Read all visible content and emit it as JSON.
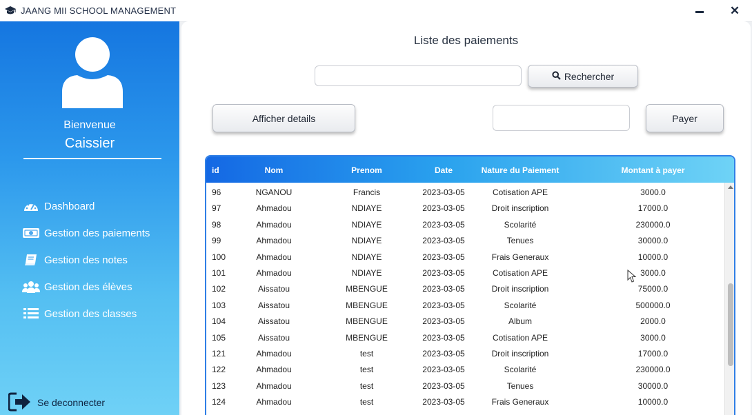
{
  "window": {
    "title": "JAANG MII SCHOOL MANAGEMENT",
    "icon": "graduation-cap-icon"
  },
  "sidebar": {
    "welcome": "Bienvenue",
    "role": "Caissier",
    "items": [
      {
        "label": "Dashboard",
        "icon": "dashboard-gauge-icon"
      },
      {
        "label": "Gestion des paiements",
        "icon": "money-bill-icon"
      },
      {
        "label": "Gestion des notes",
        "icon": "book-icon"
      },
      {
        "label": "Gestion des élèves",
        "icon": "users-icon"
      },
      {
        "label": "Gestion des classes",
        "icon": "list-icon"
      }
    ],
    "logout": "Se deconnecter"
  },
  "main": {
    "title": "Liste des paiements",
    "search": {
      "value": "",
      "button_label": "Rechercher"
    },
    "details_button": "Afficher details",
    "amount_input": {
      "value": ""
    },
    "pay_button": "Payer"
  },
  "table": {
    "columns": [
      "id",
      "Nom",
      "Prenom",
      "Date",
      "Nature du Paiement",
      "Montant à payer"
    ],
    "rows": [
      [
        "96",
        "NGANOU",
        "Francis",
        "2023-03-05",
        "Cotisation APE",
        "3000.0"
      ],
      [
        "97",
        "Ahmadou",
        "NDIAYE",
        "2023-03-05",
        "Droit inscription",
        "17000.0"
      ],
      [
        "98",
        "Ahmadou",
        "NDIAYE",
        "2023-03-05",
        "Scolarité",
        "230000.0"
      ],
      [
        "99",
        "Ahmadou",
        "NDIAYE",
        "2023-03-05",
        "Tenues",
        "30000.0"
      ],
      [
        "100",
        "Ahmadou",
        "NDIAYE",
        "2023-03-05",
        "Frais Generaux",
        "10000.0"
      ],
      [
        "101",
        "Ahmadou",
        "NDIAYE",
        "2023-03-05",
        "Cotisation APE",
        "3000.0"
      ],
      [
        "102",
        "Aissatou",
        "MBENGUE",
        "2023-03-05",
        "Droit inscription",
        "75000.0"
      ],
      [
        "103",
        "Aissatou",
        "MBENGUE",
        "2023-03-05",
        "Scolarité",
        "500000.0"
      ],
      [
        "104",
        "Aissatou",
        "MBENGUE",
        "2023-03-05",
        "Album",
        "2000.0"
      ],
      [
        "105",
        "Aissatou",
        "MBENGUE",
        "2023-03-05",
        "Cotisation APE",
        "3000.0"
      ],
      [
        "121",
        "Ahmadou",
        "test",
        "2023-03-05",
        "Droit inscription",
        "17000.0"
      ],
      [
        "122",
        "Ahmadou",
        "test",
        "2023-03-05",
        "Scolarité",
        "230000.0"
      ],
      [
        "123",
        "Ahmadou",
        "test",
        "2023-03-05",
        "Tenues",
        "30000.0"
      ],
      [
        "124",
        "Ahmadou",
        "test",
        "2023-03-05",
        "Frais Generaux",
        "10000.0"
      ]
    ]
  },
  "colors": {
    "sidebar_top": "#1576e0",
    "sidebar_bottom": "#6fd1f6",
    "table_border": "#2f7fe6"
  }
}
